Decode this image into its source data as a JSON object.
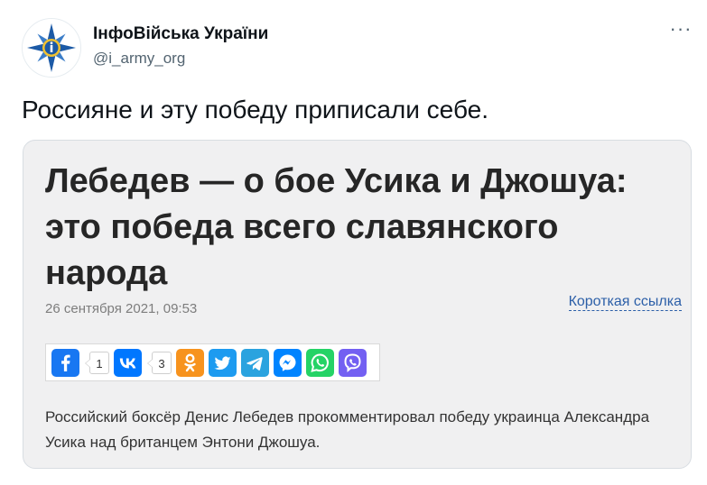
{
  "author": {
    "name": "ІнфоВійська України",
    "handle": "@i_army_org",
    "avatar_icon": "armed-forces-emblem-icon"
  },
  "more_button": {
    "label": "···"
  },
  "tweet": {
    "text": "Россияне и эту победу приписали себе."
  },
  "card": {
    "headline": "Лебедев — о бое Усика и Джошуа: это победа всего славянского народа",
    "date": "26 сентября 2021, 09:53",
    "short_link": "Короткая ссылка",
    "lead": "Российский боксёр Денис Лебедев прокомментировал победу украинца Александра Усика над британцем Энтони Джошуа.",
    "share": [
      {
        "icon": "facebook-icon",
        "color": "#1877f2",
        "count": "1"
      },
      {
        "icon": "vk-icon",
        "color": "#0077ff",
        "count": "3"
      },
      {
        "icon": "odnoklassniki-icon",
        "color": "#f7931e"
      },
      {
        "icon": "twitter-icon",
        "color": "#1d9bf0"
      },
      {
        "icon": "telegram-icon",
        "color": "#2aa3df"
      },
      {
        "icon": "messenger-icon",
        "color": "#0084ff"
      },
      {
        "icon": "whatsapp-icon",
        "color": "#25d366"
      },
      {
        "icon": "viber-icon",
        "color": "#7360f2"
      }
    ]
  },
  "colors": {
    "handle": "#536471",
    "card_background": "#f0f0f1",
    "link": "#2c5fa8"
  }
}
